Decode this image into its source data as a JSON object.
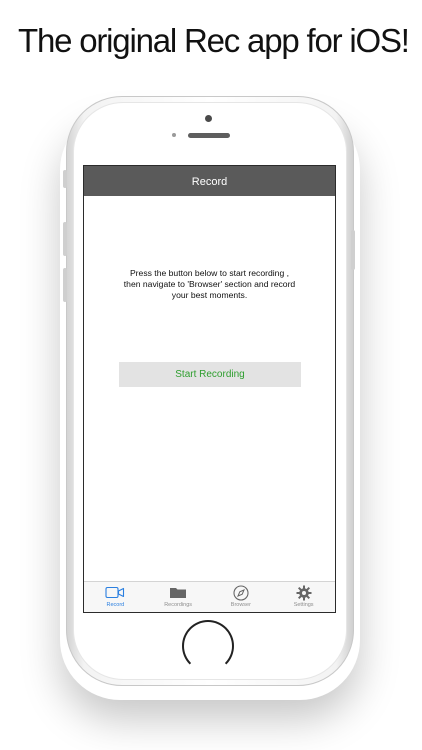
{
  "headline": "The original  Rec app for iOS!",
  "navbar": {
    "title": "Record"
  },
  "instructions": "Press the button below to start recording ,\nthen navigate to 'Browser' section and record\nyour best moments.",
  "start_button": {
    "label": "Start Recording"
  },
  "tabs": [
    {
      "label": "Record",
      "icon": "video-camera-icon",
      "active": true
    },
    {
      "label": "Recordings",
      "icon": "folder-icon",
      "active": false
    },
    {
      "label": "Browser",
      "icon": "compass-icon",
      "active": false
    },
    {
      "label": "Settings",
      "icon": "gear-icon",
      "active": false
    }
  ],
  "colors": {
    "navbar_bg": "#5a5a5a",
    "accent_green": "#2e9e2e",
    "active_tab_blue": "#2a7fe0"
  }
}
